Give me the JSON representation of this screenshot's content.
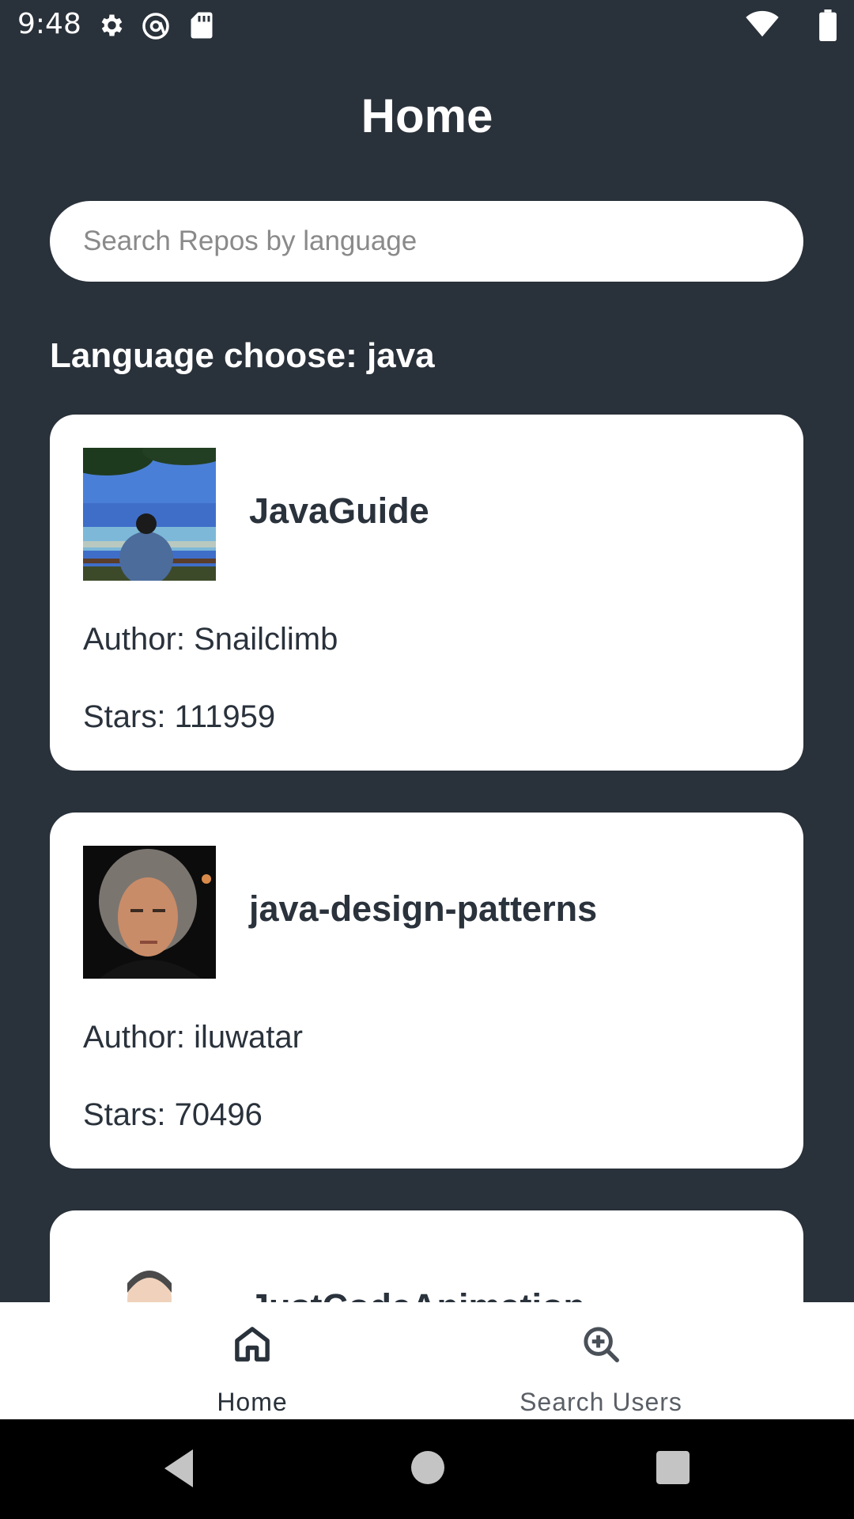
{
  "status_bar": {
    "time": "9:48",
    "left_icons": [
      "settings-gear-icon",
      "at-sign-icon",
      "sd-card-icon"
    ],
    "right_icons": [
      "wifi-icon",
      "battery-icon"
    ]
  },
  "header": {
    "title": "Home"
  },
  "search": {
    "placeholder": "Search Repos by language",
    "value": ""
  },
  "section": {
    "label": "Language choose: java"
  },
  "repos": [
    {
      "name": "JavaGuide",
      "author": "Author: Snailclimb",
      "stars": "Stars: 111959",
      "avatar": "photo-person-by-sea"
    },
    {
      "name": "java-design-patterns",
      "author": "Author: iluwatar",
      "stars": "Stars: 70496",
      "avatar": "photo-man-portrait"
    },
    {
      "name": "JustCodeAnimation",
      "author": "",
      "stars": "",
      "avatar": "cartoon-avatar"
    }
  ],
  "bottom_nav": {
    "items": [
      {
        "label": "Home",
        "icon": "home-icon",
        "active": true
      },
      {
        "label": "Search Users",
        "icon": "search-plus-icon",
        "active": false
      }
    ],
    "active_color": "#29313a",
    "inactive_color": "#5a5f66"
  },
  "system_nav": {
    "buttons": [
      "back-icon",
      "home-circle-icon",
      "recents-square-icon"
    ]
  },
  "colors": {
    "background": "#29313a",
    "card": "#ffffff",
    "text_dark": "#2a323c"
  }
}
